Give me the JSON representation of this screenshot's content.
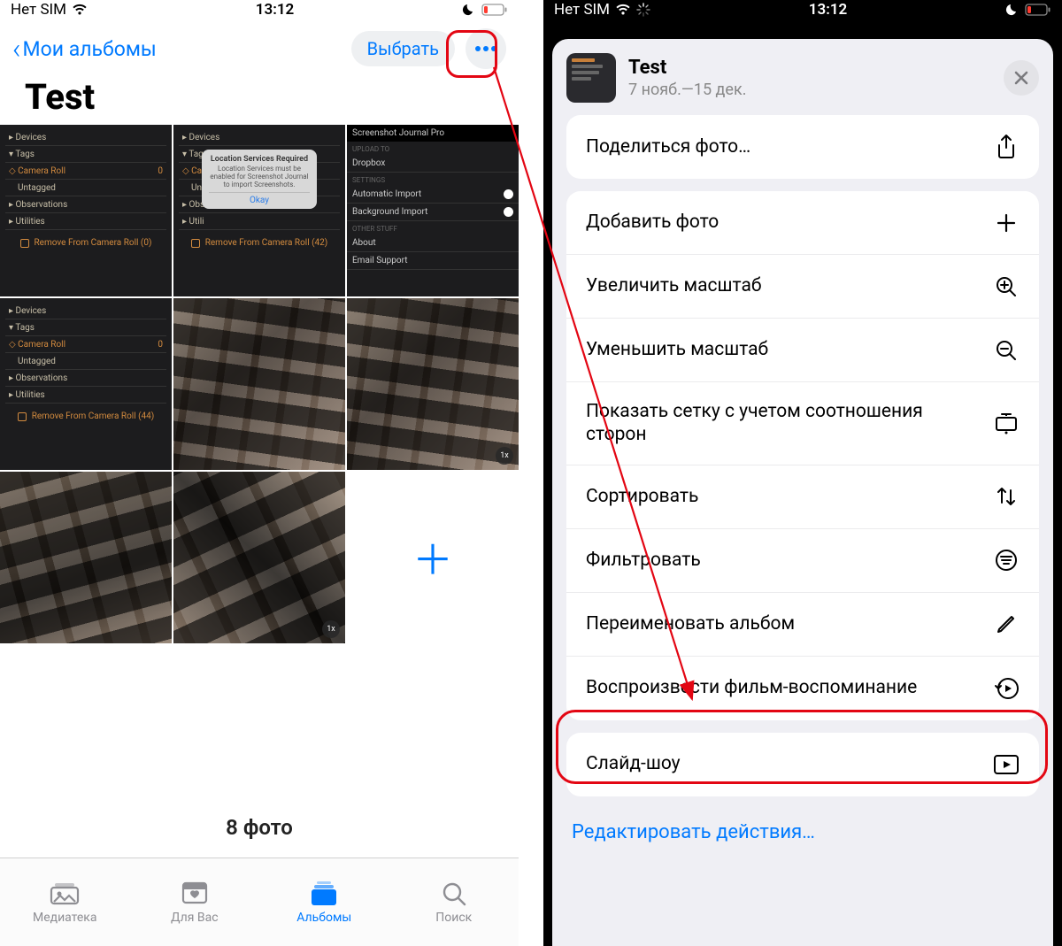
{
  "status": {
    "carrier": "Нет SIM",
    "time": "13:12"
  },
  "left": {
    "back_label": "Мои альбомы",
    "select_label": "Выбрать",
    "album_title": "Test",
    "count_label": "8 фото",
    "tabs": {
      "library": "Медиатека",
      "for_you": "Для Вас",
      "albums": "Альбомы",
      "search": "Поиск"
    },
    "thumbs": {
      "dark_rows": {
        "devices": "Devices",
        "tags": "Tags",
        "camera_roll": "Camera Roll",
        "untagged": "Untagged",
        "observations": "Observations",
        "utilities": "Utilities",
        "zero": "0",
        "remove0": "Remove From Camera Roll (0)",
        "remove42": "Remove From Camera Roll (42)",
        "remove44": "Remove From Camera Roll (44)"
      },
      "dialog": {
        "title": "Location Services Required",
        "body": "Location Services must be enabled for Screenshot Journal to import Screenshots.",
        "okay": "Okay"
      },
      "settings": {
        "title": "Screenshot Journal Pro",
        "upload_to": "Upload To",
        "dropbox": "Dropbox",
        "settings_sec": "Settings",
        "auto_import": "Automatic Import",
        "bg_import": "Background Import",
        "other": "Other Stuff",
        "about": "About",
        "email": "Email Support"
      },
      "badge": "1x"
    }
  },
  "right": {
    "sheet_title": "Test",
    "sheet_sub": "7 нояб.—15 дек.",
    "share": "Поделиться фото…",
    "add_photos": "Добавить фото",
    "zoom_in": "Увеличить масштаб",
    "zoom_out": "Уменьшить масштаб",
    "aspect_grid": "Показать сетку с учетом соотношения сторон",
    "sort": "Сортировать",
    "filter": "Фильтровать",
    "rename": "Переименовать альбом",
    "memory": "Воспроизвести фильм-воспоминание",
    "slideshow": "Слайд-шоу",
    "edit_actions": "Редактировать действия…"
  }
}
